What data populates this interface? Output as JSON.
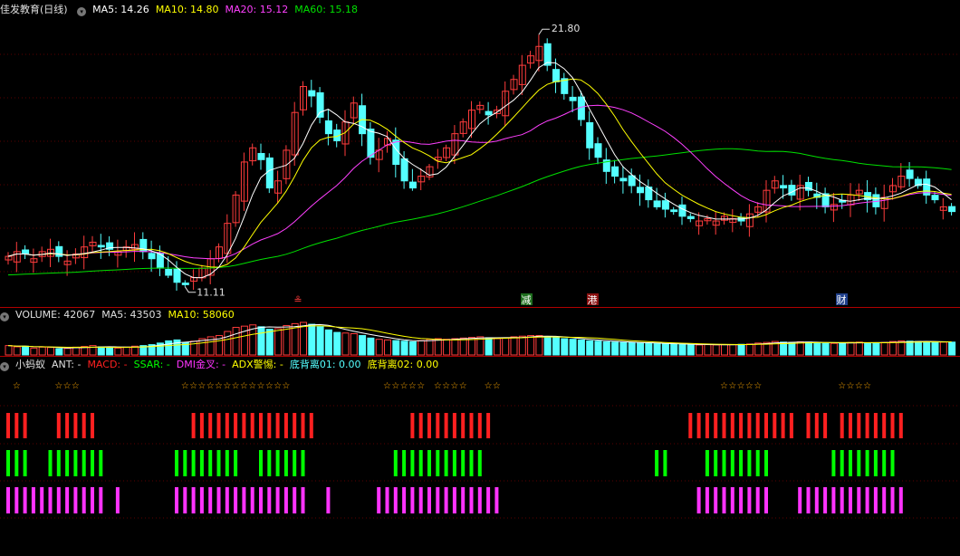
{
  "header": {
    "stock_name": "佳发教育(日线)",
    "ma5": "MA5: 14.26",
    "ma10": "MA10: 14.80",
    "ma20": "MA20: 15.12",
    "ma60": "MA60: 15.18"
  },
  "volume_header": {
    "volume": "VOLUME: 42067",
    "ma5": "MA5: 43503",
    "ma10": "MA10: 58060"
  },
  "indicator_header": {
    "name": "小蚂蚁",
    "ant": "ANT: -",
    "macd": "MACD: -",
    "ssar": "SSAR: -",
    "dmi": "DMI金叉: -",
    "adx": "ADX警惕: -",
    "div01": "底背离01: 0.00",
    "div02": "底背离02: 0.00"
  },
  "colors": {
    "ma5": "#ffffff",
    "ma10": "#ffff00",
    "ma20": "#ff40ff",
    "ma60": "#00e000",
    "up": "#ff3c3c",
    "down": "#54ffff",
    "frame": "#b00000"
  },
  "chart_data": [
    {
      "type": "candlestick",
      "title": "佳发教育(日线)",
      "y_range": [
        10.6,
        22.5
      ],
      "annotations": {
        "high": "21.80",
        "low": "11.11"
      },
      "event_markers": [
        {
          "label": "≗",
          "color": "#ff3c3c"
        },
        {
          "label": "减",
          "color": "#ffffff",
          "bg": "#1e6e1e"
        },
        {
          "label": "港",
          "color": "#ffffff",
          "bg": "#8a1010"
        },
        {
          "label": "财",
          "color": "#ffffff",
          "bg": "#1f3f8a"
        }
      ],
      "closes": [
        12.4,
        12.6,
        12.5,
        12.3,
        12.6,
        12.7,
        12.4,
        12.2,
        12.5,
        12.8,
        13.0,
        12.8,
        12.7,
        12.6,
        12.8,
        12.9,
        12.6,
        12.3,
        11.9,
        11.6,
        11.3,
        11.2,
        11.5,
        11.9,
        12.3,
        12.8,
        13.8,
        15.0,
        16.4,
        17.0,
        16.5,
        15.3,
        15.6,
        16.9,
        18.5,
        19.6,
        19.2,
        18.3,
        17.6,
        17.3,
        18.1,
        18.9,
        17.6,
        16.6,
        16.9,
        17.4,
        16.3,
        15.6,
        15.3,
        15.8,
        16.2,
        16.6,
        17.0,
        17.6,
        18.1,
        18.6,
        18.8,
        18.4,
        18.6,
        19.4,
        19.9,
        20.5,
        20.9,
        21.3,
        20.5,
        19.8,
        19.3,
        19.0,
        18.2,
        17.0,
        16.6,
        16.0,
        15.8,
        15.6,
        15.4,
        15.1,
        14.8,
        14.5,
        14.4,
        14.3,
        14.1,
        14.0,
        13.9,
        14.0,
        13.9,
        14.1,
        14.0,
        13.9,
        14.2,
        14.5,
        15.2,
        15.6,
        15.3,
        15.0,
        15.4,
        15.2,
        14.9,
        14.5,
        14.6,
        14.7,
        15.0,
        15.2,
        14.8,
        14.5,
        14.9,
        15.4,
        15.8,
        15.7,
        15.4,
        15.0,
        14.8,
        14.5,
        14.3
      ]
    },
    {
      "type": "bar",
      "title": "VOLUME",
      "values": [
        30,
        26,
        28,
        22,
        25,
        24,
        20,
        21,
        25,
        27,
        30,
        26,
        24,
        22,
        25,
        28,
        30,
        33,
        38,
        45,
        48,
        40,
        44,
        52,
        58,
        62,
        75,
        88,
        92,
        96,
        90,
        82,
        84,
        94,
        100,
        104,
        98,
        90,
        80,
        72,
        70,
        68,
        62,
        54,
        50,
        48,
        46,
        44,
        42,
        46,
        50,
        52,
        50,
        52,
        54,
        56,
        58,
        55,
        52,
        55,
        58,
        60,
        62,
        62,
        58,
        55,
        52,
        50,
        48,
        45,
        44,
        42,
        41,
        40,
        39,
        38,
        37,
        36,
        35,
        34,
        34,
        33,
        32,
        33,
        32,
        33,
        33,
        34,
        35,
        38,
        40,
        43,
        41,
        40,
        42,
        41,
        39,
        37,
        37,
        38,
        40,
        41,
        39,
        38,
        40,
        43,
        45,
        44,
        43,
        42,
        41,
        41,
        41
      ]
    },
    {
      "type": "signal_strips",
      "series": [
        {
          "name": "ANT",
          "color": "#ffa800",
          "runs": [
            [
              1,
              1
            ],
            [
              6,
              8
            ],
            [
              21,
              27
            ],
            [
              28,
              33
            ],
            [
              45,
              49
            ],
            [
              51,
              54
            ],
            [
              57,
              58
            ],
            [
              85,
              89
            ],
            [
              99,
              102
            ]
          ]
        },
        {
          "name": "MACD",
          "color": "#ff2020",
          "runs": [
            [
              0,
              2
            ],
            [
              6,
              10
            ],
            [
              22,
              36
            ],
            [
              48,
              57
            ],
            [
              81,
              93
            ],
            [
              95,
              97
            ],
            [
              99,
              106
            ]
          ]
        },
        {
          "name": "SSAR",
          "color": "#00ff00",
          "runs": [
            [
              0,
              2
            ],
            [
              5,
              11
            ],
            [
              20,
              27
            ],
            [
              30,
              35
            ],
            [
              46,
              56
            ],
            [
              77,
              78
            ],
            [
              83,
              90
            ],
            [
              98,
              105
            ]
          ]
        },
        {
          "name": "DMI金叉",
          "color": "#ff33ff",
          "runs": [
            [
              0,
              11
            ],
            [
              13,
              13
            ],
            [
              20,
              35
            ],
            [
              38,
              38
            ],
            [
              44,
              58
            ],
            [
              82,
              90
            ],
            [
              94,
              106
            ]
          ]
        }
      ]
    }
  ]
}
